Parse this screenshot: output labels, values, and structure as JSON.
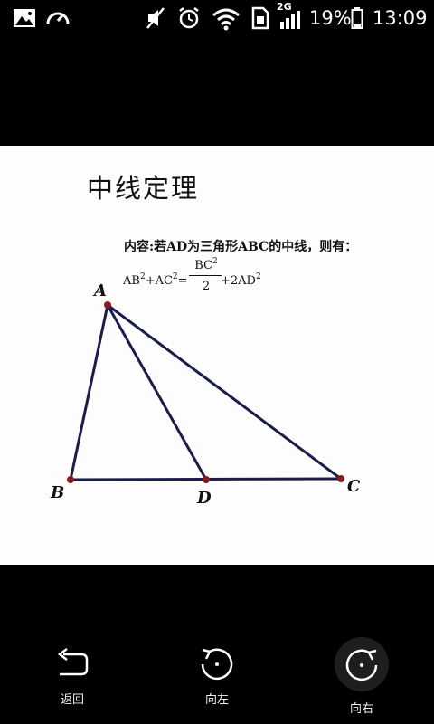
{
  "status_bar": {
    "network_label": "2G",
    "battery": "19%",
    "time": "13:09"
  },
  "image": {
    "title": "中线定理",
    "content": "内容:若AD为三角形ABC的中线，则有：",
    "formula": {
      "left": "AB",
      "plus1": "+AC",
      "eq": "=",
      "numerator": "BC",
      "denominator": "2",
      "right": "+2AD",
      "exponent": "2"
    },
    "vertices": {
      "a": "A",
      "b": "B",
      "c": "C",
      "d": "D"
    }
  },
  "nav": {
    "back": "返回",
    "rotate_left": "向左",
    "rotate_right": "向右"
  },
  "colors": {
    "line": "#1a1d4a",
    "point": "#8b1a1a"
  }
}
